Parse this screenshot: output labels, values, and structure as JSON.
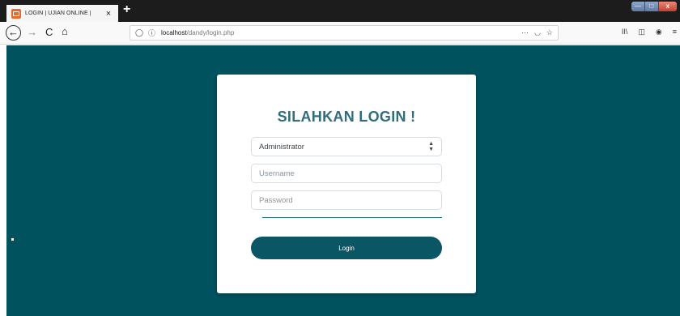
{
  "browser": {
    "tab": {
      "title": "LOGIN | UJIAN ONLINE |",
      "close": "×"
    },
    "new_tab": "+",
    "window_controls": {
      "minimize": "—",
      "maximize": "□",
      "close": "x"
    },
    "nav": {
      "back": "←",
      "forward": "→",
      "reload": "C",
      "home": "⌂"
    },
    "url": {
      "host": "localhost",
      "path": "/dandy/login.php"
    },
    "url_actions": {
      "more": "···",
      "pocket": "◡",
      "bookmark": "☆"
    },
    "toolbar_icons": {
      "library": "II\\",
      "sidebar": "◫",
      "account": "◉",
      "menu": "≡"
    }
  },
  "login": {
    "title": "SILAHKAN LOGIN !",
    "role_select": {
      "value": "Administrator",
      "arrows": [
        "▲",
        "▼"
      ]
    },
    "username": {
      "placeholder": "Username"
    },
    "password": {
      "placeholder": "Password"
    },
    "submit_label": "Login"
  },
  "colors": {
    "page_background": "#00525f",
    "title": "#2f6d7c",
    "button": "#0b5664"
  }
}
